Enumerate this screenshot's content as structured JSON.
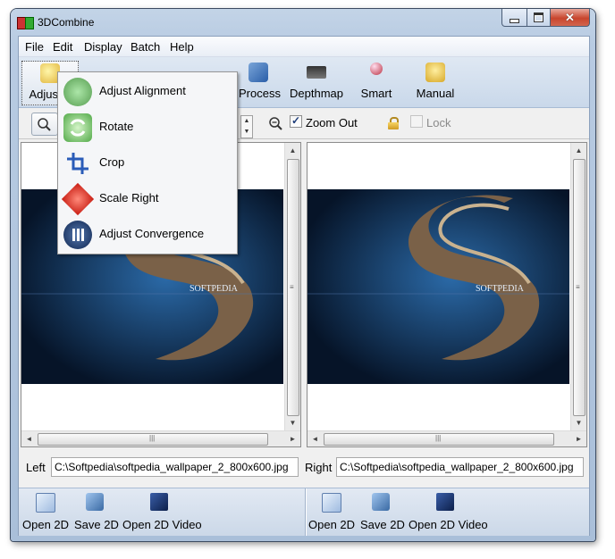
{
  "window": {
    "title": "3DCombine"
  },
  "menu": [
    "File",
    "Edit",
    "Display",
    "Batch",
    "Help"
  ],
  "toolbar": {
    "adjust_label": "Adjustm",
    "process_label": "Process",
    "depthmap_label": "Depthmap",
    "smart_label": "Smart",
    "manual_label": "Manual"
  },
  "dropdown": {
    "items": [
      {
        "label": "Adjust Alignment",
        "icon": "align-icon"
      },
      {
        "label": "Rotate",
        "icon": "rotate-icon"
      },
      {
        "label": "Crop",
        "icon": "crop-icon"
      },
      {
        "label": "Scale Right",
        "icon": "scale-icon"
      },
      {
        "label": "Adjust Convergence",
        "icon": "convergence-icon"
      }
    ]
  },
  "options": {
    "zoom_out_label": "Zoom Out",
    "zoom_out_checked": true,
    "lock_label": "Lock",
    "lock_checked": false
  },
  "panes": {
    "left": {
      "label": "Left",
      "path": "C:\\Softpedia\\softpedia_wallpaper_2_800x600.jpg",
      "photo_text": "SOFTPEDIA"
    },
    "right": {
      "label": "Right",
      "path": "C:\\Softpedia\\softpedia_wallpaper_2_800x600.jpg",
      "photo_text": "SOFTPEDIA"
    }
  },
  "bottom": {
    "left": {
      "open": "Open 2D",
      "save": "Save 2D",
      "video": "Open 2D Video"
    },
    "right": {
      "open": "Open 2D",
      "save": "Save 2D",
      "video": "Open 2D Video"
    }
  }
}
